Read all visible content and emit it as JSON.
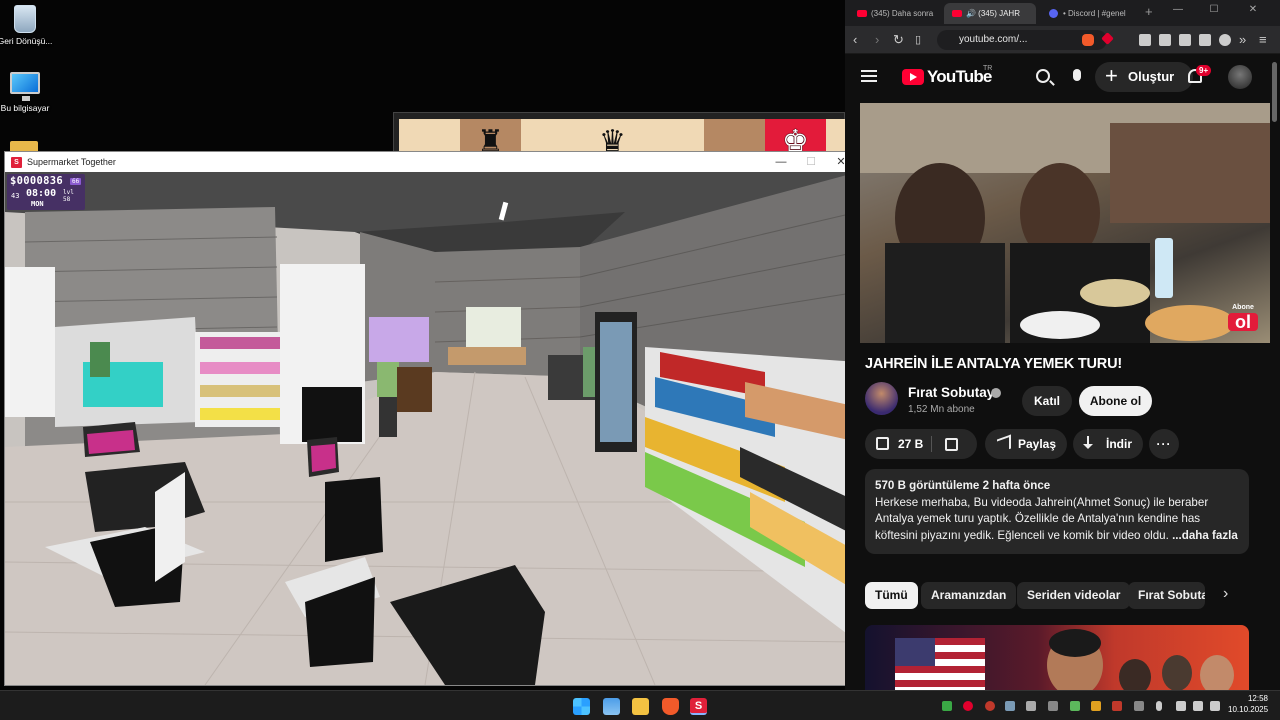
{
  "desktop": {
    "icons": [
      {
        "label": "Geri Dönüşü..."
      },
      {
        "label": "Bu bilgisayar"
      }
    ]
  },
  "game": {
    "window_title": "Supermarket Together",
    "icon_letter": "S",
    "controls": {
      "minimize": "—",
      "maximize": "☐",
      "close": "✕"
    },
    "hud": {
      "money": "$0000836",
      "money_sub": "66",
      "level": "43",
      "time": "08:00",
      "day": "MON",
      "right_top": "lvl",
      "right_bottom": "58"
    }
  },
  "chess": {
    "pieces": [
      "♜",
      "♛",
      "♚"
    ]
  },
  "browser": {
    "tabs": [
      {
        "label": "(345) Daha sonra"
      },
      {
        "label": "🔊 (345) JAHR"
      },
      {
        "label": "• Discord | #genel"
      }
    ],
    "new_tab": "+",
    "window_controls": {
      "minimize": "—",
      "maximize": "☐",
      "close": "✕"
    },
    "nav": {
      "back": "‹",
      "forward": "›",
      "reload": "↻"
    },
    "url": "youtube.com/...",
    "menu": "≡"
  },
  "youtube": {
    "logo_text": "YouTube",
    "region": "TR",
    "create_label": "Oluştur",
    "notif_count": "9+",
    "video": {
      "overlay_top": "Abone",
      "overlay_bottom": "ol"
    },
    "title": "JAHREİN İLE ANTALYA YEMEK TURU!",
    "channel": {
      "name": "Fırat Sobutay",
      "subscribers": "1,52 Mn abone",
      "join_label": "Katıl",
      "subscribe_label": "Abone ol"
    },
    "actions": {
      "likes": "27 B",
      "share_label": "Paylaş",
      "download_label": "İndir",
      "more_label": "···"
    },
    "description": {
      "meta": "570 B görüntüleme  2 hafta önce",
      "text": "Herkese merhaba, Bu videoda Jahrein(Ahmet Sonuç) ile beraber Antalya yemek turu yaptık. Özellikle de Antalya'nın kendine has köftesini piyazını yedik. Eğlenceli ve komik bir video oldu. ",
      "more_label": " ...daha fazla"
    },
    "chips": [
      {
        "label": "Tümü"
      },
      {
        "label": "Aramanızdan"
      },
      {
        "label": "Seriden videolar"
      },
      {
        "label": "Fırat Sobutay"
      }
    ],
    "chips_next": "›"
  },
  "taskbar": {
    "game_icon_letter": "S",
    "time": "12:58",
    "date": "10.10.2025"
  }
}
